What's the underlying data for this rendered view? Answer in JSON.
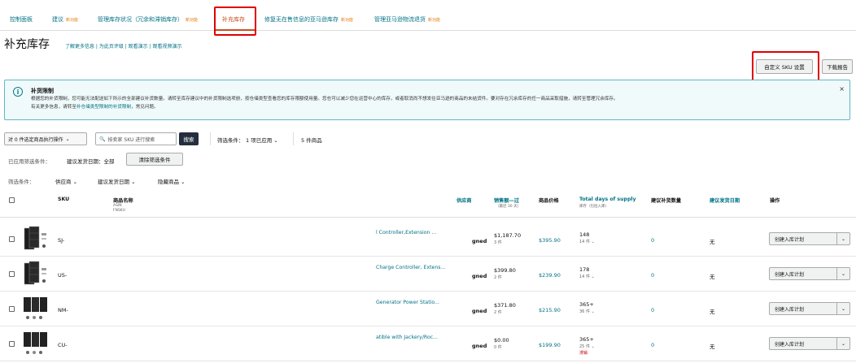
{
  "tabs": [
    {
      "label": "控制面板",
      "beta": ""
    },
    {
      "label": "建议",
      "beta": "新功能"
    },
    {
      "label": "管理库存状况（冗余和滞销库存）",
      "beta": "新功能"
    },
    {
      "label": "补充库存",
      "beta": ""
    },
    {
      "label": "修复无在售信息的亚马逊库存",
      "beta": "新功能"
    },
    {
      "label": "管理亚马逊物流退货",
      "beta": "新功能"
    }
  ],
  "page": {
    "title": "补充库存",
    "sublinks": "了解更多信息 | 为此页评级 | 观看演示 | 观看视频演示"
  },
  "buttons": {
    "custom_sku": "自定义 SKU 设置",
    "download": "下载报告"
  },
  "alert": {
    "heading": "补货限制",
    "line1": "根据您的补货限制，您可能无法配送如下所示的全部建议补货数量。请转至库存建议中的补货限制选项册，按仓储类型查看您的库存限额使用量。您也可以减少您在运营中心的库存，或者取消尚不想发往亚马逊的商品的未结货件。要对存在冗余库存的任一商品采取措施，请转至管理冗余库存。",
    "line2_prefix": "有关更多信息，请转至",
    "line2_link": "补仓储类型限制的补货限制",
    "line2_suffix": "，常见问题。",
    "close": "×"
  },
  "toolbar": {
    "bulk_action": "对 0 件选定商品执行操作",
    "search_placeholder": "按卖家 SKU 进行搜索",
    "search_button": "搜索",
    "filter_label": "筛选条件：",
    "filter_value": "1 项已应用",
    "count": "5 件商品",
    "applied_label": "已应用筛选条件：",
    "applied_value": "建议发货日期：全部",
    "clear_button": "清除筛选条件",
    "filter2_label": "筛选条件：",
    "filter_supplier": "供应商",
    "filter_ship_date": "建议发货日期",
    "filter_hidden": "隐藏商品"
  },
  "headers": {
    "sku": "SKU",
    "product": "商品名称",
    "product_sub1": "ASIN",
    "product_sub2": "FNSKU",
    "supplier": "供应商",
    "sales": "销售额—过",
    "sales_sub": "（最近 30 天）",
    "price": "商品价格",
    "days": "Total days of supply",
    "days_sub": "库存（包括入库）",
    "qty": "建议补货数量",
    "ship_date": "建议发货日期",
    "action": "操作"
  },
  "rows": [
    {
      "sku": "SJ-",
      "name": "l Controller,Extension ...",
      "sup": "gned",
      "sales": "$1,187.70",
      "units": "3 件",
      "price": "$395.90",
      "days": "148",
      "days_sub": "14 件",
      "qty": "0",
      "date": "无",
      "action": "创建入库计划",
      "note": ""
    },
    {
      "sku": "US-",
      "name": "Charge Controller, Extens...",
      "sup": "gned",
      "sales": "$399.80",
      "units": "2 件",
      "price": "$239.90",
      "days": "178",
      "days_sub": "14 件",
      "qty": "0",
      "date": "无",
      "action": "创建入库计划",
      "note": ""
    },
    {
      "sku": "NM-",
      "name": "Generator Power Statio...",
      "sup": "gned",
      "sales": "$371.80",
      "units": "2 件",
      "price": "$215.90",
      "days": "365+",
      "days_sub": "36 件",
      "qty": "0",
      "date": "无",
      "action": "创建入库计划",
      "note": ""
    },
    {
      "sku": "CU-",
      "name": "atible with Jackery/Roc...",
      "sup": "gned",
      "sales": "$0.00",
      "units": "0 件",
      "price": "$199.90",
      "days": "365+",
      "days_sub": "25 件",
      "qty": "0",
      "date": "无",
      "action": "创建入库计划",
      "note": "滞销"
    }
  ],
  "colors": {
    "link": "#007185",
    "highlight": "#e00000",
    "beta": "#e47911"
  }
}
